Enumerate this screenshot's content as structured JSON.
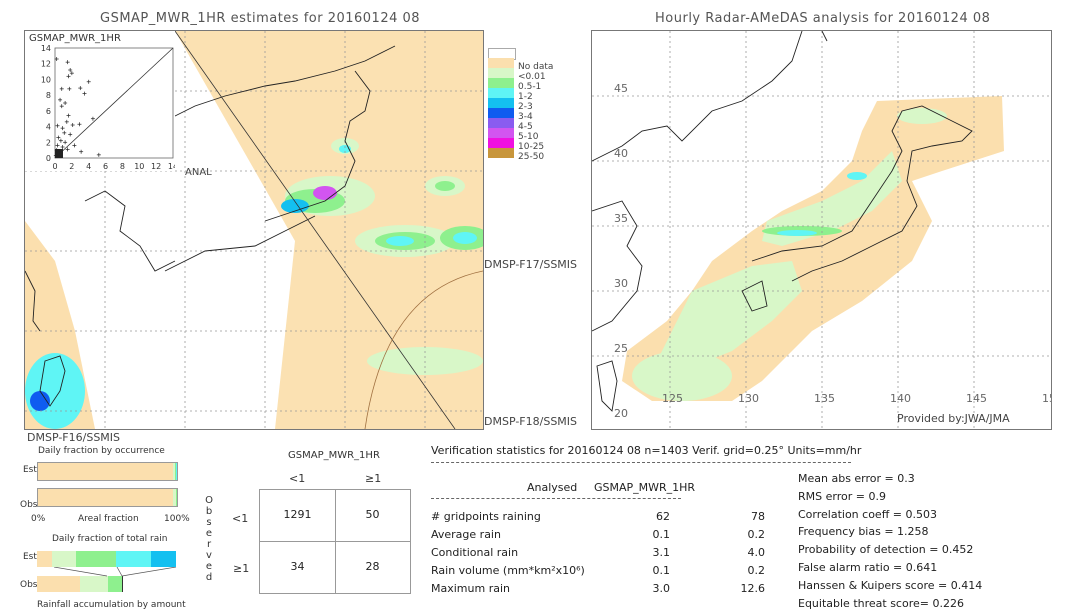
{
  "left_panel": {
    "title": "GSMAP_MWR_1HR estimates for 20160124 08",
    "scatter_label": "GSMAP_MWR_1HR",
    "scatter_xlabel": "ANAL",
    "scatter_ticks_y": [
      "14",
      "12",
      "10",
      "8",
      "6",
      "4",
      "2",
      "0"
    ],
    "scatter_ticks_x": [
      "0",
      "2",
      "4",
      "6",
      "8",
      "10",
      "12",
      "14"
    ],
    "satellite_labels": {
      "top_right": "DMSP-F17/SSMIS",
      "bottom_right": "DMSP-F18/SSMIS",
      "bottom_left": "DMSP-F16/SSMIS"
    }
  },
  "right_panel": {
    "title": "Hourly Radar-AMeDAS analysis for 20160124 08",
    "lat_labels": [
      "45",
      "40",
      "35",
      "30",
      "25",
      "20"
    ],
    "lon_labels": [
      "125",
      "130",
      "135",
      "140",
      "145",
      "15"
    ],
    "credit": "Provided by:JWA/JMA"
  },
  "legend": {
    "items": [
      {
        "label": "",
        "color": "#ffffff"
      },
      {
        "label": "No data",
        "color": "#fbdfae"
      },
      {
        "label": "<0.01",
        "color": "#d8f7c8"
      },
      {
        "label": "0.5-1",
        "color": "#8ef08e"
      },
      {
        "label": "1-2",
        "color": "#5ff5f5"
      },
      {
        "label": "2-3",
        "color": "#14c0f0"
      },
      {
        "label": "3-4",
        "color": "#0f5cf0"
      },
      {
        "label": "4-5",
        "color": "#8a5cf0"
      },
      {
        "label": "5-10",
        "color": "#d255f0"
      },
      {
        "label": "10-25",
        "color": "#f010e0"
      },
      {
        "label": "25-50",
        "color": "#c8963c"
      }
    ]
  },
  "fraction_charts": {
    "occurrence_title": "Daily fraction by occurrence",
    "est_label": "Est",
    "obs_label": "Obs",
    "axis_left": "0%",
    "axis_mid": "Areal fraction",
    "axis_right": "100%",
    "total_rain_title": "Daily fraction of total rain",
    "accumulation_title": "Rainfall accumulation by amount"
  },
  "contingency": {
    "header": "GSMAP_MWR_1HR",
    "col_labels": [
      "<1",
      "≥1"
    ],
    "row_labels": [
      "<1",
      "≥1"
    ],
    "side_label": "Observed",
    "cells": [
      [
        "1291",
        "50"
      ],
      [
        "34",
        "28"
      ]
    ]
  },
  "verification": {
    "header": "Verification statistics for 20160124 08   n=1403   Verif. grid=0.25°  Units=mm/hr",
    "col_analysed": "Analysed",
    "col_gsmap": "GSMAP_MWR_1HR",
    "rows": [
      {
        "label": "# gridpoints raining",
        "analysed": "62",
        "gsmap": "78"
      },
      {
        "label": "Average rain",
        "analysed": "0.1",
        "gsmap": "0.2"
      },
      {
        "label": "Conditional rain",
        "analysed": "3.1",
        "gsmap": "4.0"
      },
      {
        "label": "Rain volume (mm*km²x10⁶)",
        "analysed": "0.1",
        "gsmap": "0.2"
      },
      {
        "label": "Maximum rain",
        "analysed": "3.0",
        "gsmap": "12.6"
      }
    ],
    "scores": [
      "Mean abs error = 0.3",
      "RMS error = 0.9",
      "Correlation coeff = 0.503",
      "Frequency bias = 1.258",
      "Probability of detection = 0.452",
      "False alarm ratio = 0.641",
      "Hanssen & Kuipers score = 0.414",
      "Equitable threat score= 0.226"
    ]
  },
  "chart_data": [
    {
      "type": "scatter",
      "title": "GSMAP_MWR_1HR",
      "xlabel": "ANAL",
      "ylabel": "GSMAP_MWR_1HR",
      "xlim": [
        0,
        14
      ],
      "ylim": [
        0,
        14
      ],
      "points": [
        [
          0.2,
          12.6
        ],
        [
          1.5,
          12.2
        ],
        [
          1.8,
          11.2
        ],
        [
          2.0,
          10.8
        ],
        [
          1.6,
          10.4
        ],
        [
          0.8,
          8.8
        ],
        [
          1.7,
          8.8
        ],
        [
          3.0,
          8.9
        ],
        [
          4.0,
          9.7
        ],
        [
          3.5,
          8.2
        ],
        [
          0.6,
          7.4
        ],
        [
          1.2,
          7.0
        ],
        [
          0.8,
          6.6
        ],
        [
          1.6,
          5.4
        ],
        [
          1.4,
          4.6
        ],
        [
          2.1,
          4.2
        ],
        [
          2.9,
          4.3
        ],
        [
          4.5,
          5.0
        ],
        [
          0.3,
          4.1
        ],
        [
          0.9,
          3.8
        ],
        [
          1.1,
          3.2
        ],
        [
          1.8,
          3.0
        ],
        [
          0.4,
          2.6
        ],
        [
          0.7,
          2.2
        ],
        [
          1.2,
          2.0
        ],
        [
          0.3,
          1.6
        ],
        [
          0.9,
          1.4
        ],
        [
          0.2,
          1.0
        ],
        [
          0.5,
          0.6
        ],
        [
          1.5,
          1.1
        ],
        [
          2.3,
          1.6
        ],
        [
          0.1,
          0.3
        ],
        [
          3.1,
          0.8
        ],
        [
          5.2,
          0.4
        ]
      ]
    },
    {
      "type": "bar",
      "title": "Daily fraction by occurrence",
      "categories": [
        "Est",
        "Obs"
      ],
      "series": [
        {
          "name": "No data / <0.01 area",
          "values": [
            0.97,
            0.97
          ]
        },
        {
          "name": "<0.01",
          "values": [
            0.015,
            0.02
          ]
        },
        {
          "name": "0.5-1",
          "values": [
            0.01,
            0.01
          ]
        },
        {
          "name": "1-2",
          "values": [
            0.005,
            0.0
          ]
        }
      ],
      "xlabel": "Areal fraction",
      "xlim": [
        0,
        1
      ]
    },
    {
      "type": "bar",
      "title": "Daily fraction of total rain",
      "categories": [
        "Est",
        "Obs"
      ],
      "series": [
        {
          "name": "No data",
          "values": [
            0.11,
            0.31
          ]
        },
        {
          "name": "<0.01",
          "values": [
            0.17,
            0.21
          ]
        },
        {
          "name": "0.5-1",
          "values": [
            0.29,
            0.1
          ]
        },
        {
          "name": "1-2",
          "values": [
            0.25,
            0.0
          ]
        },
        {
          "name": "2-3",
          "values": [
            0.18,
            0.0
          ]
        }
      ],
      "xlabel": "Rainfall accumulation by amount"
    }
  ]
}
